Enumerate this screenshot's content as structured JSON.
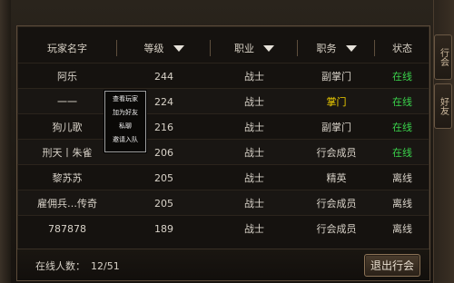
{
  "window": {
    "side_tab_1": "行会",
    "side_tab_2": "好友"
  },
  "table": {
    "columns": [
      {
        "label": "玩家名字"
      },
      {
        "label": "等级"
      },
      {
        "label": "职业"
      },
      {
        "label": "职务"
      },
      {
        "label": "状态"
      }
    ],
    "rows": [
      {
        "name": "阿乐",
        "level": "244",
        "job": "战士",
        "role": "副掌门",
        "status": "在线"
      },
      {
        "name": "一一",
        "level": "224",
        "job": "战士",
        "role": "掌门",
        "status": "在线"
      },
      {
        "name": "狗儿歌",
        "level": "216",
        "job": "战士",
        "role": "副掌门",
        "status": "在线"
      },
      {
        "name": "刑天丨朱雀",
        "level": "206",
        "job": "战士",
        "role": "行会成员",
        "status": "在线"
      },
      {
        "name": "黎苏苏",
        "level": "205",
        "job": "战士",
        "role": "精英",
        "status": "离线"
      },
      {
        "name": "雇佣兵…传奇",
        "level": "205",
        "job": "战士",
        "role": "行会成员",
        "status": "离线"
      },
      {
        "name": "787878",
        "level": "189",
        "job": "战士",
        "role": "行会成员",
        "status": "离线"
      }
    ]
  },
  "footer": {
    "online_label": "在线人数：",
    "online_value": "12/51",
    "exit_button": "退出行会"
  },
  "context_menu": {
    "items": [
      "查看玩家",
      "加为好友",
      "私聊",
      "邀请入队"
    ]
  },
  "colors": {
    "online": "#3ad24b",
    "leader": "#f1d000",
    "offline": "#d8d2c8"
  }
}
